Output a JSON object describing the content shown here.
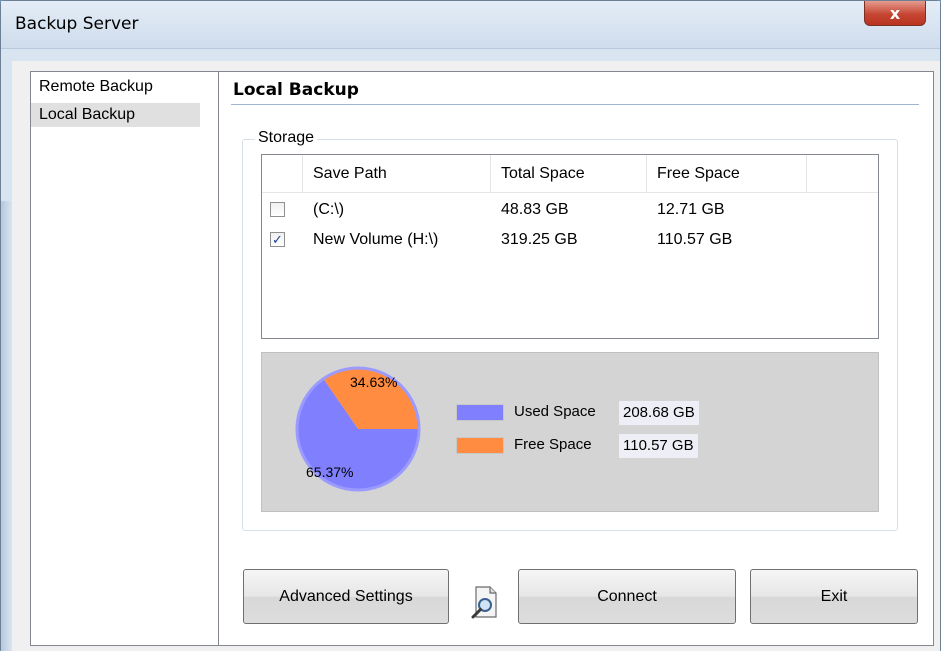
{
  "window": {
    "title": "Backup Server",
    "close_glyph": "x"
  },
  "sidebar": {
    "items": [
      {
        "label": "Remote Backup",
        "selected": false
      },
      {
        "label": "Local Backup",
        "selected": true
      }
    ]
  },
  "panel": {
    "title": "Local Backup",
    "storage": {
      "group_label": "Storage",
      "columns": [
        "",
        "Save Path",
        "Total Space",
        "Free Space",
        ""
      ],
      "rows": [
        {
          "checked": false,
          "save_path": " (C:\\)",
          "total_space": "48.83 GB",
          "free_space": "12.71 GB"
        },
        {
          "checked": true,
          "save_path": "New Volume (H:\\)",
          "total_space": "319.25 GB",
          "free_space": "110.57 GB"
        }
      ]
    },
    "chart_data": {
      "type": "pie",
      "slices": [
        {
          "name": "Used Space",
          "value": 65.37,
          "label": "65.37%",
          "color": "#8080ff"
        },
        {
          "name": "Free Space",
          "value": 34.63,
          "label": "34.63%",
          "color": "#ff8c40"
        }
      ],
      "legend": [
        {
          "label": "Used Space",
          "value": "208.68 GB",
          "color": "#8080ff"
        },
        {
          "label": "Free Space",
          "value": "110.57 GB",
          "color": "#ff8c40"
        }
      ]
    }
  },
  "buttons": {
    "advanced": "Advanced Settings",
    "connect": "Connect",
    "exit": "Exit"
  },
  "icons": {
    "browse": "magnifier-document-icon"
  }
}
